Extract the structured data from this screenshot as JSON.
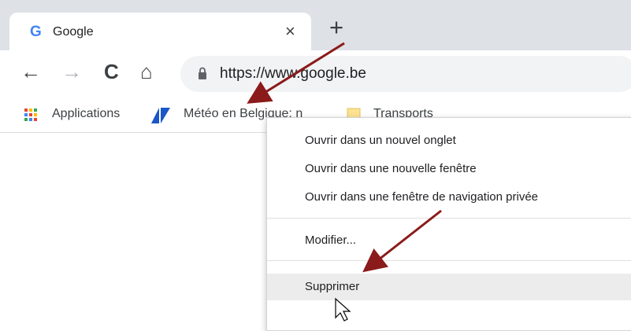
{
  "tab": {
    "favicon": "G",
    "title": "Google",
    "close": "×"
  },
  "newtab": "+",
  "nav": {
    "back": "←",
    "forward": "→",
    "reload": "C",
    "home": "⌂"
  },
  "omnibox": {
    "url": "https://www.google.be"
  },
  "bookmarks": [
    {
      "label": "Applications",
      "icon": "apps-grid-icon"
    },
    {
      "label": "Météo en Belgique: n",
      "icon": "meteo-icon"
    },
    {
      "label": "Transports",
      "icon": "folder-icon"
    }
  ],
  "context_menu": {
    "items": [
      "Ouvrir dans un nouvel onglet",
      "Ouvrir dans une nouvelle fenêtre",
      "Ouvrir dans une fenêtre de navigation privée",
      "Modifier...",
      "Supprimer"
    ]
  },
  "colors": {
    "arrow": "#8b1a1a",
    "highlight": "#ececec",
    "tabstrip": "#dee1e6"
  }
}
